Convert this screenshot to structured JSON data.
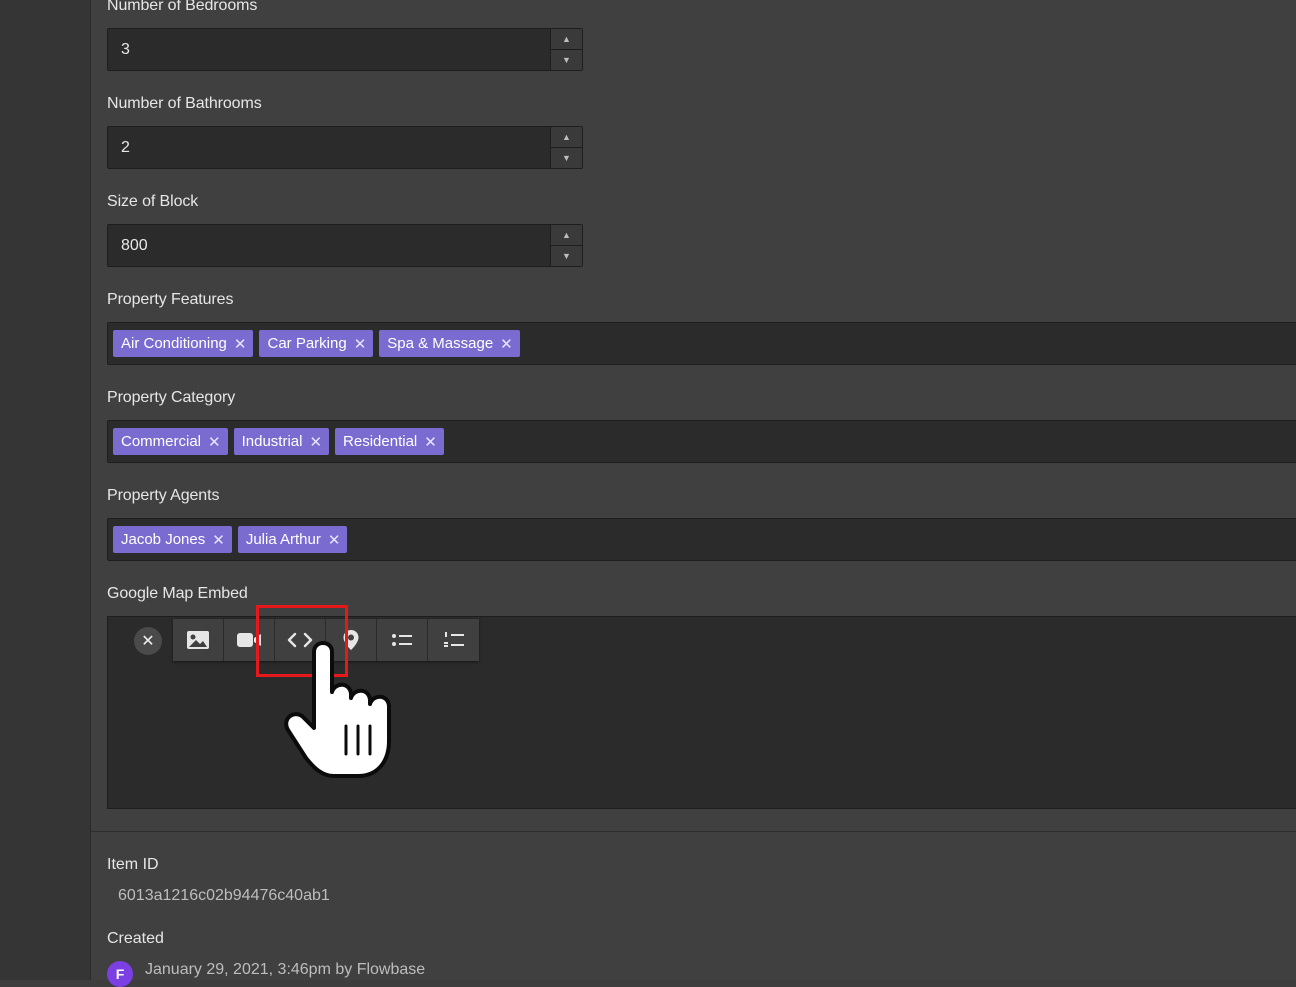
{
  "fields": {
    "bedrooms": {
      "label": "Number of Bedrooms",
      "value": "3"
    },
    "bathrooms": {
      "label": "Number of Bathrooms",
      "value": "2"
    },
    "block_size": {
      "label": "Size of Block",
      "value": "800"
    }
  },
  "features": {
    "label": "Property Features",
    "tags": [
      "Air Conditioning",
      "Car Parking",
      "Spa & Massage"
    ]
  },
  "category": {
    "label": "Property Category",
    "tags": [
      "Commercial",
      "Industrial",
      "Residential"
    ]
  },
  "agents": {
    "label": "Property Agents",
    "tags": [
      "Jacob Jones",
      "Julia Arthur"
    ]
  },
  "map_embed": {
    "label": "Google Map Embed",
    "toolbar": [
      "image-icon",
      "video-icon",
      "code-embed-icon",
      "map-pin-icon",
      "bulleted-list-icon",
      "numbered-list-icon"
    ]
  },
  "meta": {
    "item_id_label": "Item ID",
    "item_id": "6013a1216c02b94476c40ab1",
    "created_label": "Created",
    "created_value": "January 29, 2021, 3:46pm by Flowbase"
  },
  "colors": {
    "tag": "#7a6bd0",
    "highlight": "#e5191b",
    "avatar": "#7b3fe4"
  }
}
